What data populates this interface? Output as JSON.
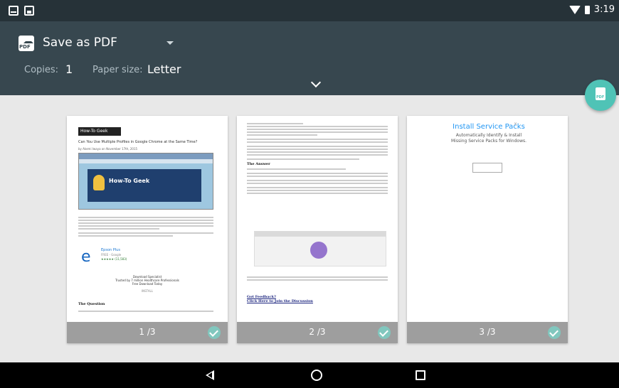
{
  "status_bar": {
    "time": "3:19",
    "left_icons": [
      "gmail-icon",
      "image-icon"
    ],
    "right_icons": [
      "wifi-icon",
      "battery-icon"
    ]
  },
  "print_header": {
    "destination_icon": "pdf-download-icon",
    "destination": "Save as PDF",
    "copies_label": "Copies:",
    "copies_value": "1",
    "paper_label": "Paper size:",
    "paper_value": "Letter"
  },
  "fab": {
    "icon": "pdf-download-icon",
    "color": "#4fc3b6"
  },
  "pages": [
    {
      "label": "1 /3",
      "checked": true,
      "site_logo": "How-To Geek",
      "article_title": "Can You Use Multiple Profiles in Google Chrome at the Same Time?",
      "byline": "by Akemi Iwaya on November 17th, 2015",
      "banner_text": "How-To Geek",
      "ad_title": "Epson Plus",
      "ad_sub": "FREE - Google",
      "ad_rating": "★★★★★ (11,583)",
      "ad_line1": "Download Specialist",
      "ad_line2": "Trusted by 7 million Healthcare Professionals",
      "ad_line3": "Free Download Today",
      "install": "INSTALL",
      "section_heading": "The Question"
    },
    {
      "label": "2 /3",
      "checked": true,
      "heading": "The Answer",
      "link1": "Got Feedback?",
      "link2": "Click Here to Join the Discussion"
    },
    {
      "label": "3 /3",
      "checked": true,
      "ad_title": "Install Service Packs",
      "ad_desc": "Automatically Identify & Install Missing Service Packs for Windows."
    }
  ],
  "navigation": {
    "back_icon": "back-triangle-icon",
    "home_icon": "home-circle-icon",
    "recents_icon": "recents-square-icon"
  }
}
